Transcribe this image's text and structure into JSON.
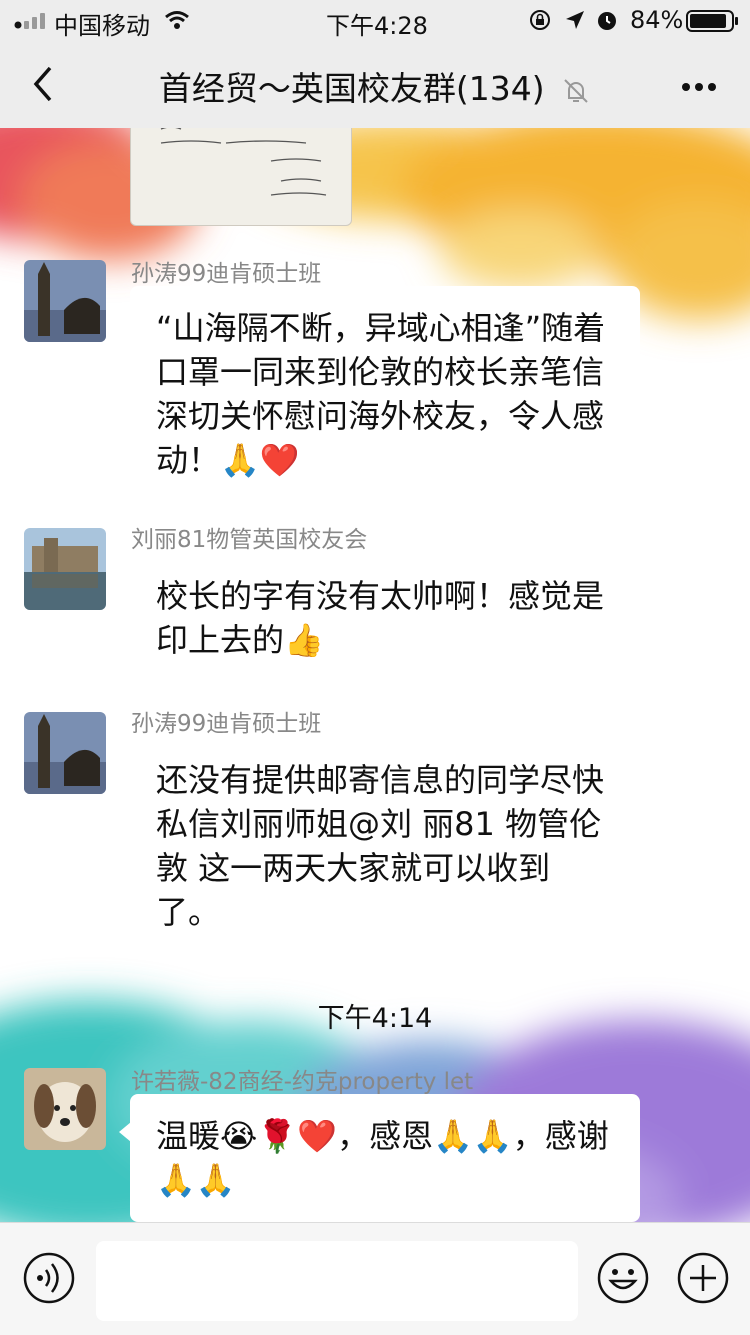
{
  "status_bar": {
    "carrier": "中国移动",
    "time": "下午4:28",
    "battery": "84%",
    "icons": [
      "signal-icon",
      "wifi-icon",
      "orientation-lock-icon",
      "location-icon",
      "alarm-icon",
      "battery-icon"
    ]
  },
  "nav": {
    "title": "首经贸～英国校友群(134)",
    "icons": [
      "back-icon",
      "mute-icon",
      "more-icon"
    ]
  },
  "messages": [
    {
      "sender": "孙涛99迪肯硕士班",
      "text": "“山海隔不断，异域心相逢”随着口罩一同来到伦敦的校长亲笔信深切关怀慰问海外校友，令人感动！🙏❤️"
    },
    {
      "sender": "刘丽81物管英国校友会",
      "text": "校长的字有没有太帅啊！感觉是印上去的👍"
    },
    {
      "sender": "孙涛99迪肯硕士班",
      "text": "还没有提供邮寄信息的同学尽快私信刘丽师姐@刘 丽81 物管伦敦  这一两天大家就可以收到了。"
    }
  ],
  "timestamp": "下午4:14",
  "last_message": {
    "sender": "许若薇-82商经-约克property let",
    "text": "温暖😭🌹❤️，感恩🙏🙏，感谢🙏🙏"
  },
  "colors": {
    "accent_bg": "#ededed",
    "bubble": "#ffffff"
  }
}
